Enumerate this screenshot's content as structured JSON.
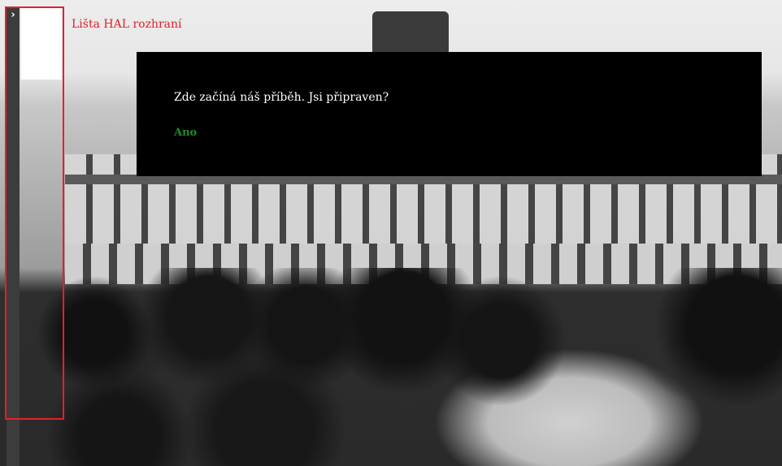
{
  "hal": {
    "toggle_glyph": "›",
    "label": "Lišta HAL rozhraní"
  },
  "dialog": {
    "prompt": "Zde začíná náš příběh. Jsi připraven?",
    "answer": "Ano"
  },
  "colors": {
    "highlight": "#e0222a",
    "answer": "#1f8a2a",
    "dialog_bg": "#000000"
  },
  "icons": {
    "toggle": "chevron-right-icon"
  }
}
